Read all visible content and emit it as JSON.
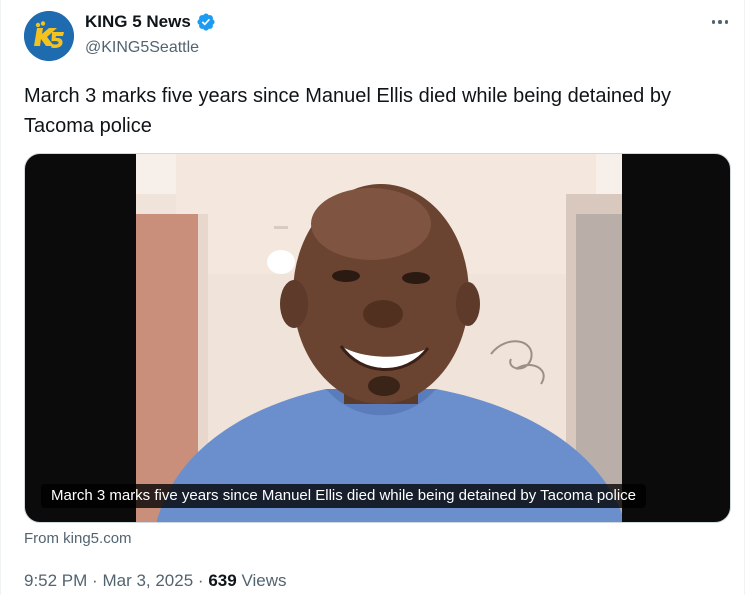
{
  "author": {
    "display_name": "KING 5 News",
    "handle": "@KING5Seattle",
    "verified": true,
    "avatar_icon": "king5-logo-icon",
    "avatar_color": "#1f6bb0",
    "verified_color": "#1d9bf0"
  },
  "tweet": {
    "text": "March 3 marks five years since Manuel Ellis died while being detained by Tacoma police"
  },
  "media": {
    "caption": "March 3 marks five years since Manuel Ellis died while being detained by Tacoma police",
    "source": "From king5.com"
  },
  "meta": {
    "time": "9:52 PM",
    "separator": "·",
    "date": "Mar 3, 2025",
    "views_count": "639",
    "views_label": "Views"
  },
  "icons": {
    "more": "more-dots-icon"
  }
}
